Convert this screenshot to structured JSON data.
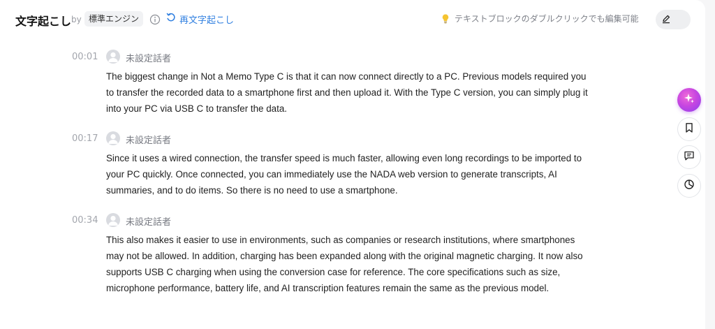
{
  "header": {
    "title": "文字起こし",
    "by_label": "by",
    "engine_label": "標準エンジン",
    "retranscribe_label": "再文字起こし",
    "hint_text": "テキストブロックのダブルクリックでも編集可能"
  },
  "entries": [
    {
      "time": "00:01",
      "speaker": "未設定話者",
      "text": "The biggest change in Not a Memo Type C is that it can now connect directly to a PC. Previous models required you to transfer the recorded data to a smartphone first and then upload it. With the Type C version, you can simply plug it into your PC via USB C to transfer the data."
    },
    {
      "time": "00:17",
      "speaker": "未設定話者",
      "text": "Since it uses a wired connection, the transfer speed is much faster, allowing even long recordings to be imported to your PC quickly. Once connected, you can immediately use the NADA web version to generate transcripts, AI summaries, and to do items. So there is no need to use a smartphone."
    },
    {
      "time": "00:34",
      "speaker": "未設定話者",
      "text": "This also makes it easier to use in environments, such as companies or research institutions, where smartphones may not be allowed. In addition, charging has been expanded along with the original magnetic charging. It now also supports USB C charging when using the conversion case for reference. The core specifications such as size, microphone performance, battery life, and AI transcription features remain the same as the previous model."
    }
  ],
  "side_toolbar": {
    "icons": [
      "sparkle-icon",
      "bookmark-icon",
      "comment-icon",
      "pie-chart-icon"
    ]
  },
  "colors": {
    "accent": "#2f7fe0",
    "ai_gradient_start": "#f06ad8",
    "ai_gradient_end": "#8d3ff0"
  }
}
